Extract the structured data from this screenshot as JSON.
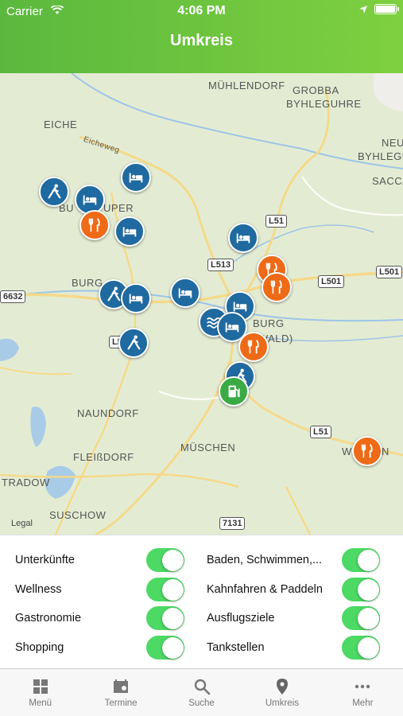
{
  "status": {
    "carrier": "Carrier",
    "time": "4:06 PM"
  },
  "header": {
    "title": "Umkreis"
  },
  "map": {
    "places": [
      "MÜHLENDORF",
      "GROBBA",
      "BYHLEGUHRE",
      "EICHE",
      "NEU",
      "BYHLEGUH",
      "SACCA",
      "BURG",
      "NAUNDORF",
      "FLEIßDORF",
      "MÜSCHEN",
      "TRADOW",
      "SUSCHOW",
      "W",
      "N",
      "BU",
      "UPER",
      "BURG",
      "(WALD)"
    ],
    "street": "Eicheweg",
    "roads": [
      "L51",
      "L513",
      "L501",
      "L501",
      "6632",
      "L5",
      "L51",
      "7131"
    ],
    "legal": "Legal",
    "pins": [
      "hiking-pin",
      "hotel-pin",
      "hotel-pin",
      "restaurant-pin",
      "hotel-pin",
      "hotel-pin",
      "restaurant-pin",
      "hiking-pin",
      "hotel-pin",
      "hotel-pin",
      "wellness-pin",
      "hotel-pin",
      "restaurant-pin",
      "hiking-pin",
      "hiking-pin",
      "gas-station-pin",
      "restaurant-pin"
    ]
  },
  "filters": [
    {
      "label": "Unterkünfte",
      "on": true
    },
    {
      "label": "Baden, Schwimmen,...",
      "on": true
    },
    {
      "label": "Wellness",
      "on": true
    },
    {
      "label": "Kahnfahren & Paddeln",
      "on": true
    },
    {
      "label": "Gastronomie",
      "on": true
    },
    {
      "label": "Ausflugsziele",
      "on": true
    },
    {
      "label": "Shopping",
      "on": true
    },
    {
      "label": "Tankstellen",
      "on": true
    }
  ],
  "tabs": [
    {
      "label": "Menü",
      "icon": "grid-icon",
      "active": false
    },
    {
      "label": "Termine",
      "icon": "calendar-icon",
      "active": false
    },
    {
      "label": "Suche",
      "icon": "search-icon",
      "active": false
    },
    {
      "label": "Umkreis",
      "icon": "location-pin-icon",
      "active": true
    },
    {
      "label": "Mehr",
      "icon": "more-icon",
      "active": false
    }
  ],
  "colors": {
    "header": "#6cc23f",
    "toggle_on": "#4cd964",
    "pin_blue": "#1f6aa0",
    "pin_orange": "#ef6a17",
    "pin_green": "#3aaa45"
  }
}
